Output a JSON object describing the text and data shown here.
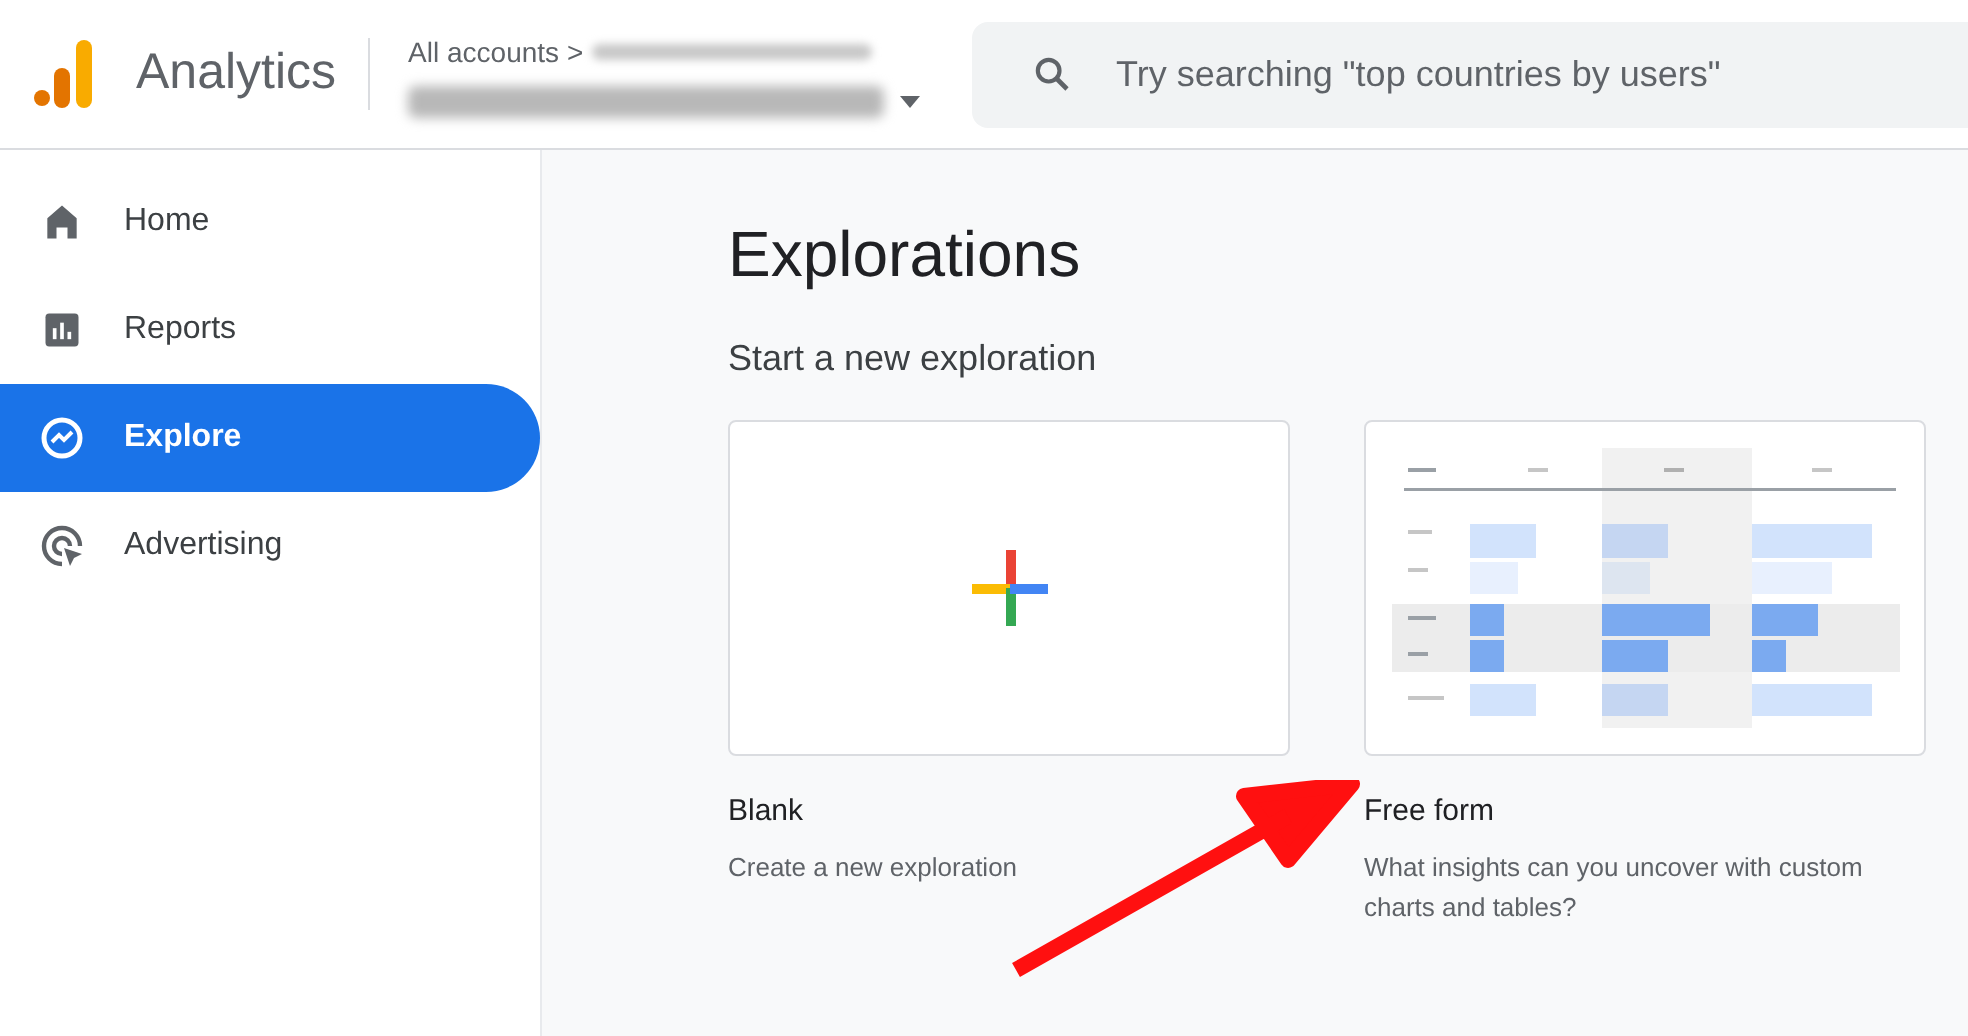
{
  "header": {
    "product": "Analytics",
    "breadcrumb": "All accounts",
    "breadcrumb_separator": ">",
    "search": {
      "placeholder": "Try searching \"top countries by users\""
    }
  },
  "sidebar": {
    "items": [
      {
        "label": "Home",
        "kind": "home",
        "selected": false
      },
      {
        "label": "Reports",
        "kind": "reports",
        "selected": false
      },
      {
        "label": "Explore",
        "kind": "explore",
        "selected": true
      },
      {
        "label": "Advertising",
        "kind": "advertising",
        "selected": false
      }
    ]
  },
  "main": {
    "title": "Explorations",
    "subtitle": "Start a new exploration",
    "templates": [
      {
        "kind": "blank",
        "title": "Blank",
        "description": "Create a new exploration"
      },
      {
        "kind": "free_form",
        "title": "Free form",
        "description": "What insights can you uncover with custom charts and tables?"
      }
    ]
  }
}
